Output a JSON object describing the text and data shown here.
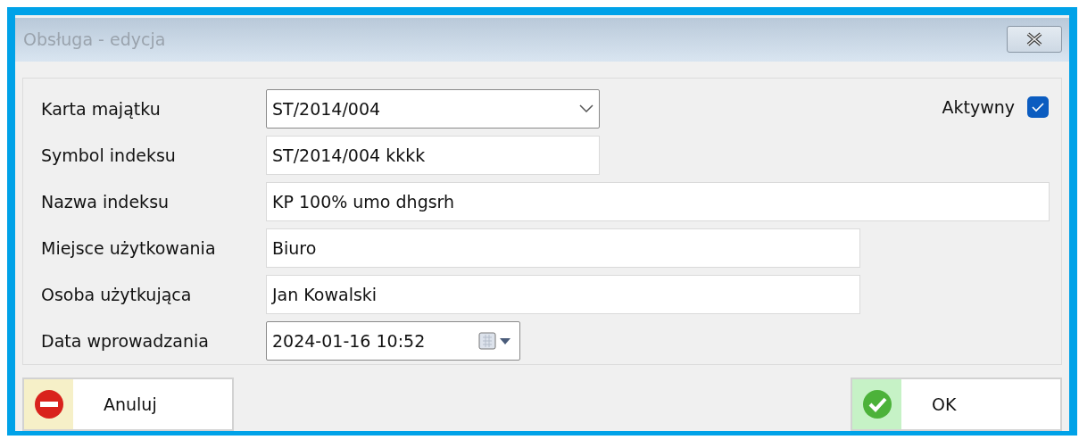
{
  "window": {
    "title": "Obsługa - edycja"
  },
  "active": {
    "label": "Aktywny",
    "checked": true
  },
  "fields": [
    {
      "label": "Karta majątku",
      "kind": "combo",
      "value": "ST/2014/004"
    },
    {
      "label": "Symbol indeksu",
      "kind": "text",
      "value": "ST/2014/004 kkkk"
    },
    {
      "label": "Nazwa indeksu",
      "kind": "text",
      "value": "KP 100% umo dhgsrh"
    },
    {
      "label": "Miejsce użytkowania",
      "kind": "text",
      "value": "Biuro"
    },
    {
      "label": "Osoba użytkująca",
      "kind": "text",
      "value": "Jan Kowalski"
    },
    {
      "label": "Data wprowadzania",
      "kind": "date",
      "value": "2024-01-16 10:52"
    }
  ],
  "buttons": [
    {
      "label": "Anuluj",
      "kind": "cancel"
    },
    {
      "label": "OK",
      "kind": "ok"
    }
  ]
}
